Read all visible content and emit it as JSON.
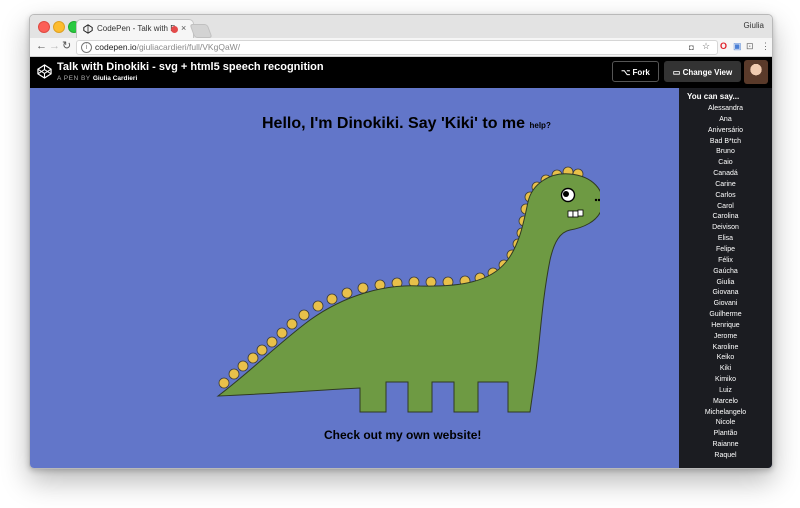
{
  "browser": {
    "tab_title": "CodePen - Talk with Dinokiki",
    "tab_close": "×",
    "profile_name": "Giulia",
    "url_domain": "codepen.io",
    "url_path": "/giuliacardieri/full/VKgQaW/",
    "nav": {
      "back": "←",
      "forward": "→",
      "reload": "↻",
      "info": "i"
    },
    "extensions": [
      "◘",
      "☆",
      "O",
      "▣",
      "⊡",
      "⋮"
    ]
  },
  "codepen": {
    "title": "Talk with Dinokiki - svg + html5 speech recognition",
    "by_label": "A PEN BY",
    "author": "Giulia Cardieri",
    "fork_label": "Fork",
    "change_view_label": "Change View"
  },
  "pen": {
    "heading": "Hello, I'm Dinokiki. Say 'Kiki' to me",
    "help": "help?",
    "website_link": "Check out my own website!"
  },
  "sidebar": {
    "heading": "You can say...",
    "names": [
      "Alessandra",
      "Ana",
      "Aniversário",
      "Bad B*tch",
      "Bruno",
      "Caio",
      "Canadá",
      "Carine",
      "Carlos",
      "Carol",
      "Carolina",
      "Deivison",
      "Elisa",
      "Felipe",
      "Félix",
      "Gaúcha",
      "Giulia",
      "Giovana",
      "Giovani",
      "Guilherme",
      "Henrique",
      "Jerome",
      "Karoline",
      "Keiko",
      "Kiki",
      "Kimiko",
      "Luiz",
      "Marcelo",
      "Michelangelo",
      "Nicole",
      "Plantão",
      "Raianne",
      "Raquel"
    ]
  },
  "colors": {
    "pen_bg": "#6276c9",
    "dino_body": "#6e9a43",
    "dino_spikes": "#e8c04a",
    "sidebar_bg": "#1b1c21",
    "header_bg": "#000000"
  }
}
